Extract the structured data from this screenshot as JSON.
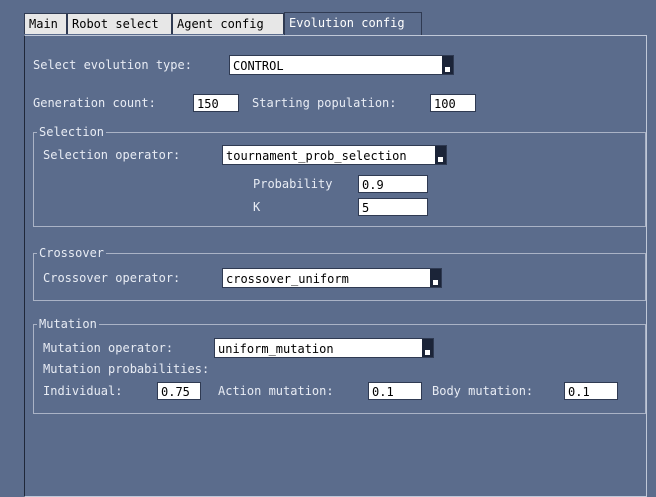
{
  "tabs": [
    "Main",
    "Robot select",
    "Agent config",
    "Evolution config"
  ],
  "evolution": {
    "type_label": "Select evolution type:",
    "type_value": "CONTROL",
    "generation_label": "Generation count:",
    "generation_value": "150",
    "population_label": "Starting population:",
    "population_value": "100"
  },
  "selection": {
    "title": "Selection",
    "operator_label": "Selection operator:",
    "operator_value": "tournament_prob_selection",
    "probability_label": "Probability",
    "probability_value": "0.9",
    "k_label": "K",
    "k_value": "5"
  },
  "crossover": {
    "title": "Crossover",
    "operator_label": "Crossover operator:",
    "operator_value": "crossover_uniform"
  },
  "mutation": {
    "title": "Mutation",
    "operator_label": "Mutation operator:",
    "operator_value": "uniform_mutation",
    "probabilities_label": "Mutation probabilities:",
    "individual_label": "Individual:",
    "individual_value": "0.75",
    "action_label": "Action mutation:",
    "action_value": "0.1",
    "body_label": "Body mutation:",
    "body_value": "0.1"
  }
}
